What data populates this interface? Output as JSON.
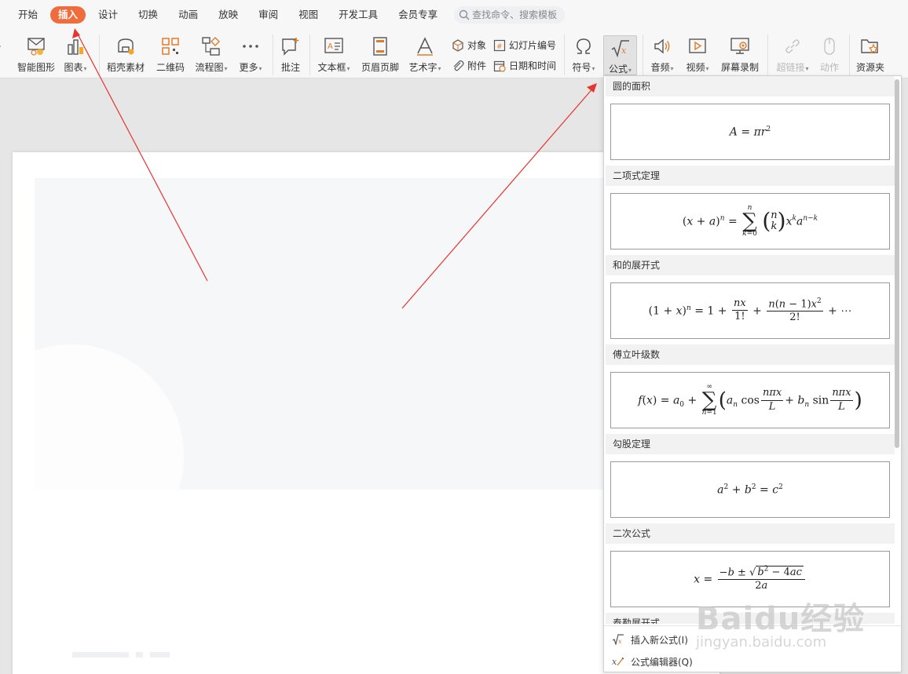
{
  "menubar": {
    "tabs": [
      "开始",
      "插入",
      "设计",
      "切换",
      "动画",
      "放映",
      "审阅",
      "视图",
      "开发工具",
      "会员专享"
    ],
    "active_tab": "插入",
    "search_placeholder": "查找命令、搜索模板"
  },
  "ribbon": {
    "smart_graphic": "智能图形",
    "chart": "图表",
    "docer_assets": "稻壳素材",
    "qrcode": "二维码",
    "flowchart": "流程图",
    "more": "更多",
    "comment": "批注",
    "textbox": "文本框",
    "header_footer": "页眉页脚",
    "wordart": "艺术字",
    "object": "对象",
    "attachment": "附件",
    "slide_number": "幻灯片编号",
    "datetime": "日期和时间",
    "symbol": "符号",
    "formula": "公式",
    "audio": "音频",
    "video": "视频",
    "screen_record": "屏幕录制",
    "hyperlink": "超链接",
    "action": "动作",
    "resources": "资源夹"
  },
  "formula_panel": {
    "sections": [
      {
        "title": "圆的面积"
      },
      {
        "title": "二项式定理"
      },
      {
        "title": "和的展开式"
      },
      {
        "title": "傅立叶级数"
      },
      {
        "title": "勾股定理"
      },
      {
        "title": "二次公式"
      },
      {
        "title": "泰勒展开式"
      }
    ],
    "insert_new": "插入新公式(I)",
    "editor": "公式编辑器(Q)"
  },
  "watermark": {
    "brand": "Baidu经验",
    "url": "jingyan.baidu.com"
  },
  "colors": {
    "accent": "#ef6c3d",
    "annotation_arrow": "#e8342f"
  }
}
